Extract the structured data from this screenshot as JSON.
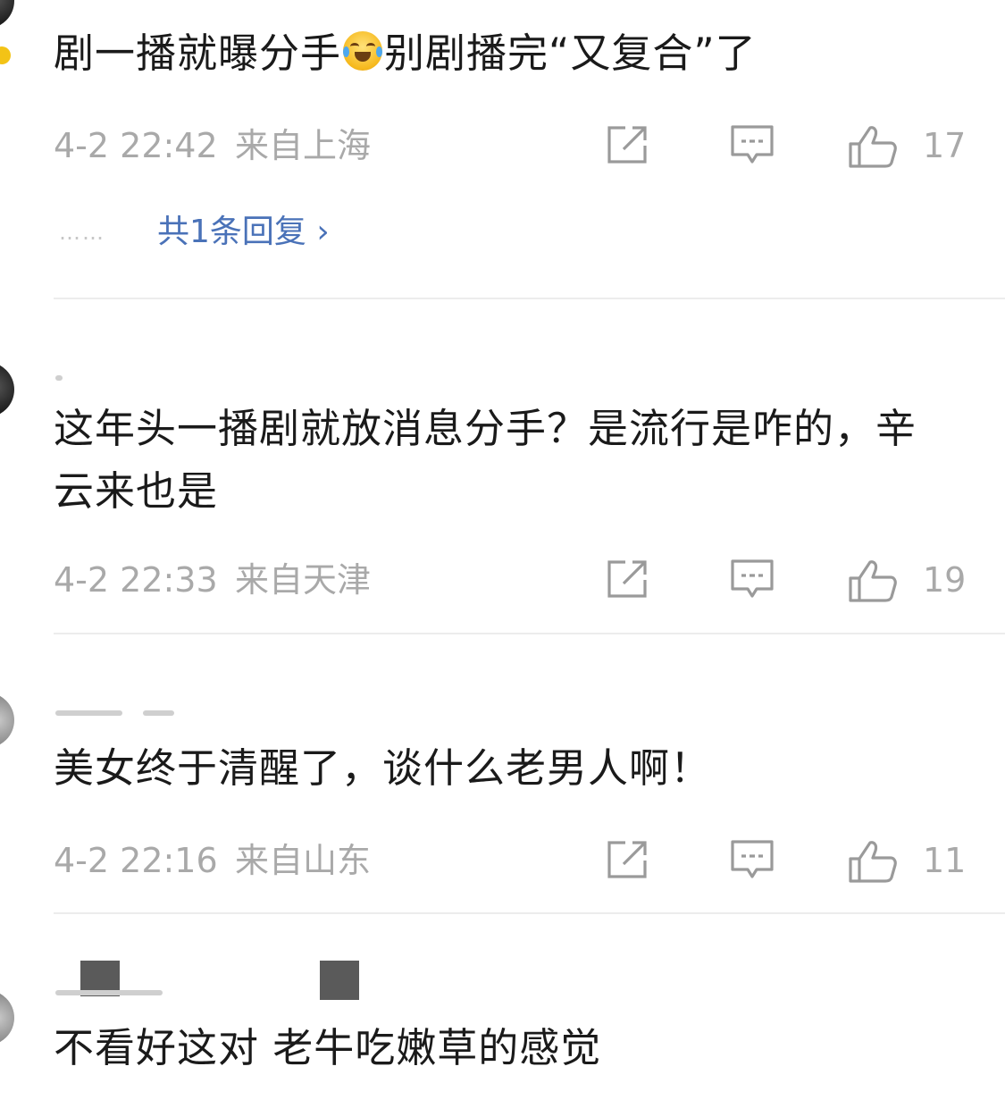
{
  "comments": [
    {
      "text": "剧一播就曝分手",
      "text_after_emoji": "别剧播完“又复合”了",
      "emoji_name": "laugh-cry-emoji",
      "time": "4-2 22:42",
      "location": "来自上海",
      "likes": "17",
      "replies_label": "共1条回复 ›",
      "replies_dots": "……"
    },
    {
      "text": "这年头一播剧就放消息分手？是流行是咋的，辛云来也是",
      "time": "4-2 22:33",
      "location": "来自天津",
      "likes": "19"
    },
    {
      "text": "美女终于清醒了，谈什么老男人啊！",
      "time": "4-2 22:16",
      "location": "来自山东",
      "likes": "11"
    },
    {
      "text": "不看好这对 老牛吃嫩草的感觉"
    }
  ],
  "icons": {
    "share": "share-icon",
    "reply": "comment-icon",
    "like": "thumb-up-icon"
  },
  "colors": {
    "text": "#1a1a1a",
    "meta": "#a9a9a9",
    "link": "#4a72b8",
    "divider": "#ececec"
  }
}
